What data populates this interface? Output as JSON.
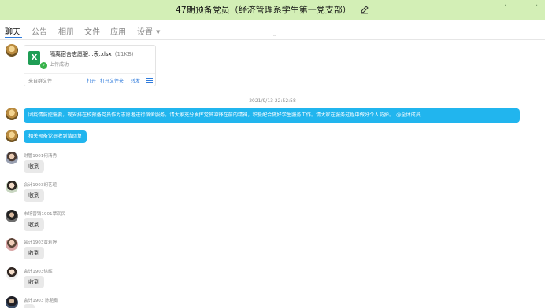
{
  "window": {
    "title": "47期预备党员（经济管理系学生第一党支部）",
    "icons": [
      "edit-icon",
      "minimize-icon",
      "maximize-icon"
    ]
  },
  "tabs": [
    {
      "label": "聊天",
      "active": true
    },
    {
      "label": "公告"
    },
    {
      "label": "相册"
    },
    {
      "label": "文件"
    },
    {
      "label": "应用"
    },
    {
      "label": "设置",
      "has_dropdown": true
    }
  ],
  "file_message": {
    "file_name": "隔离宿舍志愿服...表.xlsx",
    "file_size": "(11KB)",
    "status": "上传成功",
    "source": "来自群文件",
    "actions": [
      "打开",
      "打开文件夹",
      "转发"
    ]
  },
  "timestamp": "2021/9/13 22:52:58",
  "announcement": {
    "text": "因疫情防控需要，现安排在校预备党员作为志愿者进行宿舍服务。请大家充分发挥党员冲锋在前的精神，积极配合做好学生服务工作。请大家在服务过程中做好个人防护。",
    "mention": "@全体成员"
  },
  "prompt": "相关预备党员收到请回复",
  "replies": [
    {
      "sender": "财管1901何清秀",
      "text": "收到"
    },
    {
      "sender": "会计1903胡艺瑄",
      "text": "收到"
    },
    {
      "sender": "市场营销1901覃润民",
      "text": "收到"
    },
    {
      "sender": "会计1903黄莉婷",
      "text": "收到"
    },
    {
      "sender": "会计1903徐辉",
      "text": "收到"
    },
    {
      "sender": "会计1903 陈艳茹",
      "text": ""
    }
  ],
  "colors": {
    "title_bar": "#d3efb6",
    "accent_blue": "#2f7bdc",
    "bubble_blue": "#21b5ee",
    "bubble_gray": "#e9e9e9"
  }
}
